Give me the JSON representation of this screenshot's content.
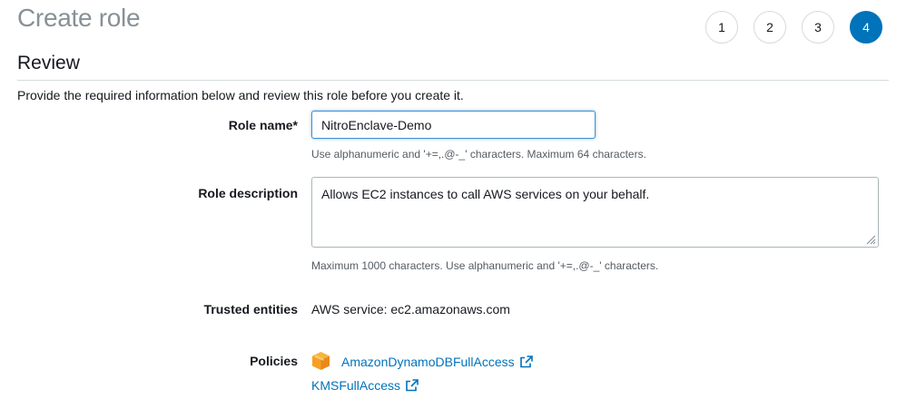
{
  "header": {
    "title": "Create role",
    "steps": [
      "1",
      "2",
      "3",
      "4"
    ],
    "active_step": "4"
  },
  "review": {
    "section_title": "Review",
    "intro": "Provide the required information below and review this role before you create it."
  },
  "role_name": {
    "label": "Role name*",
    "value": "NitroEnclave-Demo",
    "hint": "Use alphanumeric and '+=,.@-_' characters. Maximum 64 characters."
  },
  "role_description": {
    "label": "Role description",
    "value": "Allows EC2 instances to call AWS services on your behalf.",
    "hint": "Maximum 1000 characters. Use alphanumeric and '+=,.@-_' characters."
  },
  "trusted_entities": {
    "label": "Trusted entities",
    "value": "AWS service: ec2.amazonaws.com"
  },
  "policies": {
    "label": "Policies",
    "items": [
      {
        "name": "AmazonDynamoDBFullAccess",
        "icon": "aws-managed-policy-box-icon"
      },
      {
        "name": "KMSFullAccess"
      }
    ]
  },
  "colors": {
    "link": "#0073bb",
    "active_step": "#0073bb",
    "title_gray": "#879196",
    "policy_icon": "#f7a021"
  }
}
